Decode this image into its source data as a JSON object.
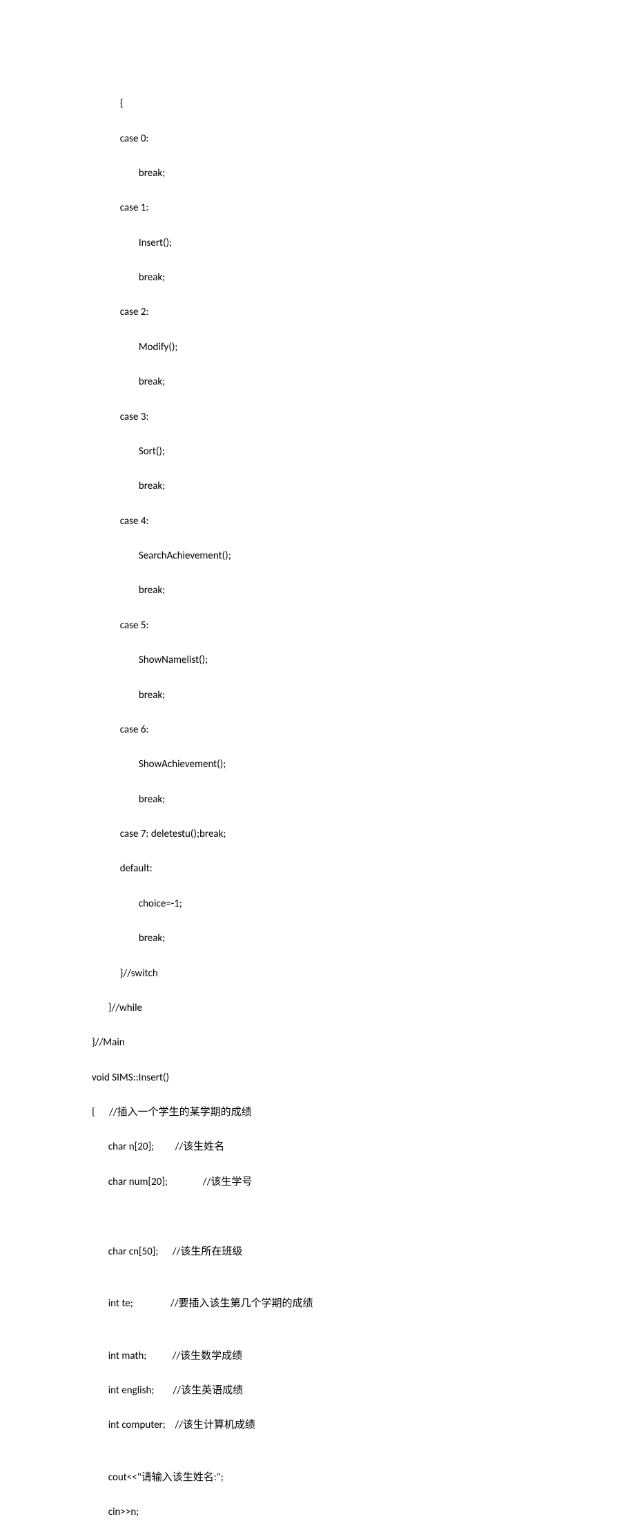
{
  "code": {
    "lines": [
      "            {",
      "            case 0:",
      "                    break;",
      "            case 1:",
      "                    Insert();",
      "                    break;",
      "            case 2:",
      "                    Modify();",
      "                    break;",
      "            case 3:",
      "                    Sort();",
      "                    break;",
      "            case 4:",
      "                    SearchAchievement();",
      "                    break;",
      "            case 5:",
      "                    ShowNamelist();",
      "                    break;",
      "            case 6:",
      "                    ShowAchievement();",
      "                    break;",
      "            case 7: deletestu();break;",
      "            default:",
      "                    choice=-1;",
      "                    break;",
      "            }//switch",
      "       }//while",
      "}//Main",
      "void SIMS::Insert()",
      "{      //插入一个学生的某学期的成绩",
      "       char n[20];         //该生姓名",
      "       char num[20];               //该生学号",
      "",
      "",
      "       char cn[50];      //该生所在班级",
      "",
      "       int te;                //要插入该生第几个学期的成绩",
      "",
      "       int math;           //该生数学成绩",
      "       int english;        //该生英语成绩",
      "       int computer;    //该生计算机成绩",
      "",
      "       cout<<\"请输入该生姓名:\";",
      "       cin>>n;"
    ]
  }
}
